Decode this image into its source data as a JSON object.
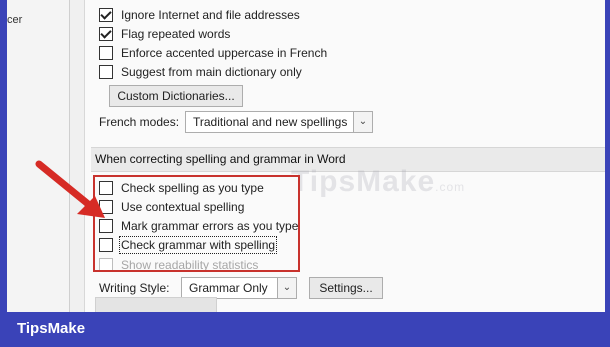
{
  "left_pane": {
    "cut_text": "cer"
  },
  "options_top": [
    {
      "label": "Ignore Internet and file addresses",
      "checked": true
    },
    {
      "label": "Flag repeated words",
      "checked": true
    },
    {
      "label": "Enforce accented uppercase in French",
      "checked": false
    },
    {
      "label": "Suggest from main dictionary only",
      "checked": false
    }
  ],
  "custom_dictionaries_button": "Custom Dictionaries...",
  "french_modes": {
    "label": "French modes:",
    "value": "Traditional and new spellings"
  },
  "section_header": "When correcting spelling and grammar in Word",
  "options_bottom": [
    {
      "label": "Check spelling as you type",
      "checked": false
    },
    {
      "label": "Use contextual spelling",
      "checked": false
    },
    {
      "label": "Mark grammar errors as you type",
      "checked": false
    },
    {
      "label": "Check grammar with spelling",
      "checked": false
    },
    {
      "label": "Show readability statistics",
      "checked": false,
      "disabled": true
    }
  ],
  "writing_style": {
    "label": "Writing Style:",
    "value": "Grammar Only",
    "settings_button": "Settings..."
  },
  "watermark": {
    "text": "TipsMake",
    "suffix": ".com"
  },
  "brand": "TipsMake",
  "colors": {
    "background": "#3a43b8",
    "annotation": "#c8322d"
  }
}
